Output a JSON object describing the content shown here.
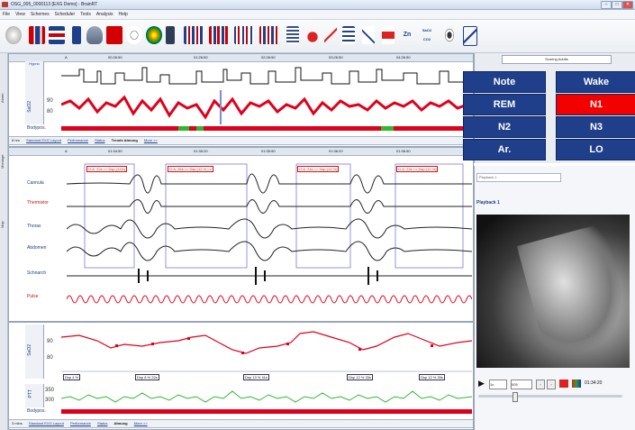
{
  "window": {
    "title": "OSG_005_0000113 [EXG Demo] - BrainRT",
    "btn_min": "–",
    "btn_max": "□",
    "btn_close": "✕"
  },
  "menu": [
    "File",
    "View",
    "Schemes",
    "Scheduler",
    "Tools",
    "Analysis",
    "Help"
  ],
  "toolbar": {
    "zn_label": "Zn",
    "sao2_label": "SaO2 CO2"
  },
  "side_tabs": {
    "alarm": "Alarm",
    "montage": "Montage",
    "map": "Map"
  },
  "top_panel": {
    "timeline": "A",
    "times": [
      "00:26:50",
      "01:26:50",
      "02:26:50",
      "03:26:50",
      "04:26:50"
    ],
    "hypno_label": "Hypno",
    "sao2_label": "SaO2",
    "sao2_ticks": [
      "90",
      "80"
    ],
    "bodypos_label": "Bodypos.",
    "epoch": "8 hrs",
    "tabs": [
      "Standard EXG Layout",
      "Performance",
      "Status",
      "Trends Atmung",
      "More >>"
    ],
    "active_tab": "Trends Atmung"
  },
  "mid_panel": {
    "marker": "A",
    "times": [
      "01:34:50",
      "01:35:20",
      "01:35:50",
      "01:36:20",
      "01:36:50"
    ],
    "channels": [
      "Cannula",
      "Thermistor",
      "Thorax",
      "Abdomen",
      "Schnarch",
      "Pulse"
    ],
    "events": [
      "O.A. 22s >> Dsp (11%)",
      "O.A. 26s >> Dsp (12 % ) 1",
      "O.A. 24s >> Dsp (13 %)",
      "O.A. 23s >> Dsp (12 %)",
      "O.A. 23s >> Dsp (12 %)"
    ]
  },
  "bottom_panel": {
    "sao2_label": "SaO2",
    "sao2_ticks": [
      "90",
      "80"
    ],
    "desat_events": [
      "Dsp 4 %",
      "Dsp 8 %  22s",
      "Dsp 13 %  41s",
      "Dsp 12 %  33s",
      "Dsp 12 %  39s"
    ],
    "ptt_label": "PTT",
    "ptt_ticks": [
      "350",
      "300"
    ],
    "bodypos_label": "Bodypos.",
    "epoch": "3 mins",
    "tabs": [
      "Standard EXG Layout",
      "Performance",
      "Status",
      "Atmung",
      "More >>"
    ],
    "active_tab": "Atmung"
  },
  "scoring": {
    "mode": "Scoring Adults",
    "buttons": [
      "Note",
      "Wake",
      "REM",
      "N1",
      "N2",
      "N3",
      "Ar.",
      "LO"
    ],
    "active": "N1"
  },
  "video": {
    "dropdown": "Playback 1",
    "title": "Playback 1",
    "speed": "1x",
    "quality": "005",
    "time": "01:34:20"
  },
  "colors": {
    "accent_blue": "#1f3f8a",
    "active_red": "#f20000",
    "signal_red": "#e0001b",
    "bodypos_green": "#2eb82e"
  }
}
